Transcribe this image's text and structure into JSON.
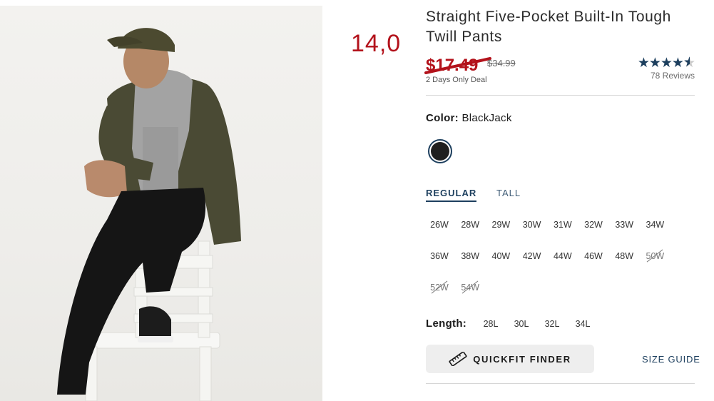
{
  "overlay_number": "14,0",
  "product": {
    "title": "Straight Five-Pocket Built-In Tough Twill Pants",
    "sale_price": "$17.49",
    "original_price": "$34.99",
    "deal_text": "2 Days Only Deal",
    "rating": {
      "stars": 4.5,
      "reviews_label": "78 Reviews"
    }
  },
  "color": {
    "label": "Color:",
    "value": "BlackJack",
    "swatch_color": "#1f1f1f",
    "selected_ring": "#1d3f5e"
  },
  "fit_tabs": [
    {
      "label": "REGULAR",
      "active": true
    },
    {
      "label": "TALL",
      "active": false
    }
  ],
  "sizes": [
    {
      "label": "26W",
      "available": true
    },
    {
      "label": "28W",
      "available": true
    },
    {
      "label": "29W",
      "available": true
    },
    {
      "label": "30W",
      "available": true
    },
    {
      "label": "31W",
      "available": true
    },
    {
      "label": "32W",
      "available": true
    },
    {
      "label": "33W",
      "available": true
    },
    {
      "label": "34W",
      "available": true
    },
    {
      "label": "36W",
      "available": true
    },
    {
      "label": "38W",
      "available": true
    },
    {
      "label": "40W",
      "available": true
    },
    {
      "label": "42W",
      "available": true
    },
    {
      "label": "44W",
      "available": true
    },
    {
      "label": "46W",
      "available": true
    },
    {
      "label": "48W",
      "available": true
    },
    {
      "label": "50W",
      "available": false
    },
    {
      "label": "52W",
      "available": false
    },
    {
      "label": "54W",
      "available": false
    }
  ],
  "length": {
    "label": "Length:",
    "options": [
      "28L",
      "30L",
      "32L",
      "34L"
    ]
  },
  "quickfit": {
    "label": "QUICKFIT FINDER",
    "icon": "ruler-icon"
  },
  "size_guide": "SIZE GUIDE",
  "colors": {
    "sale_red": "#b3121b",
    "navy": "#1d3f5e"
  }
}
